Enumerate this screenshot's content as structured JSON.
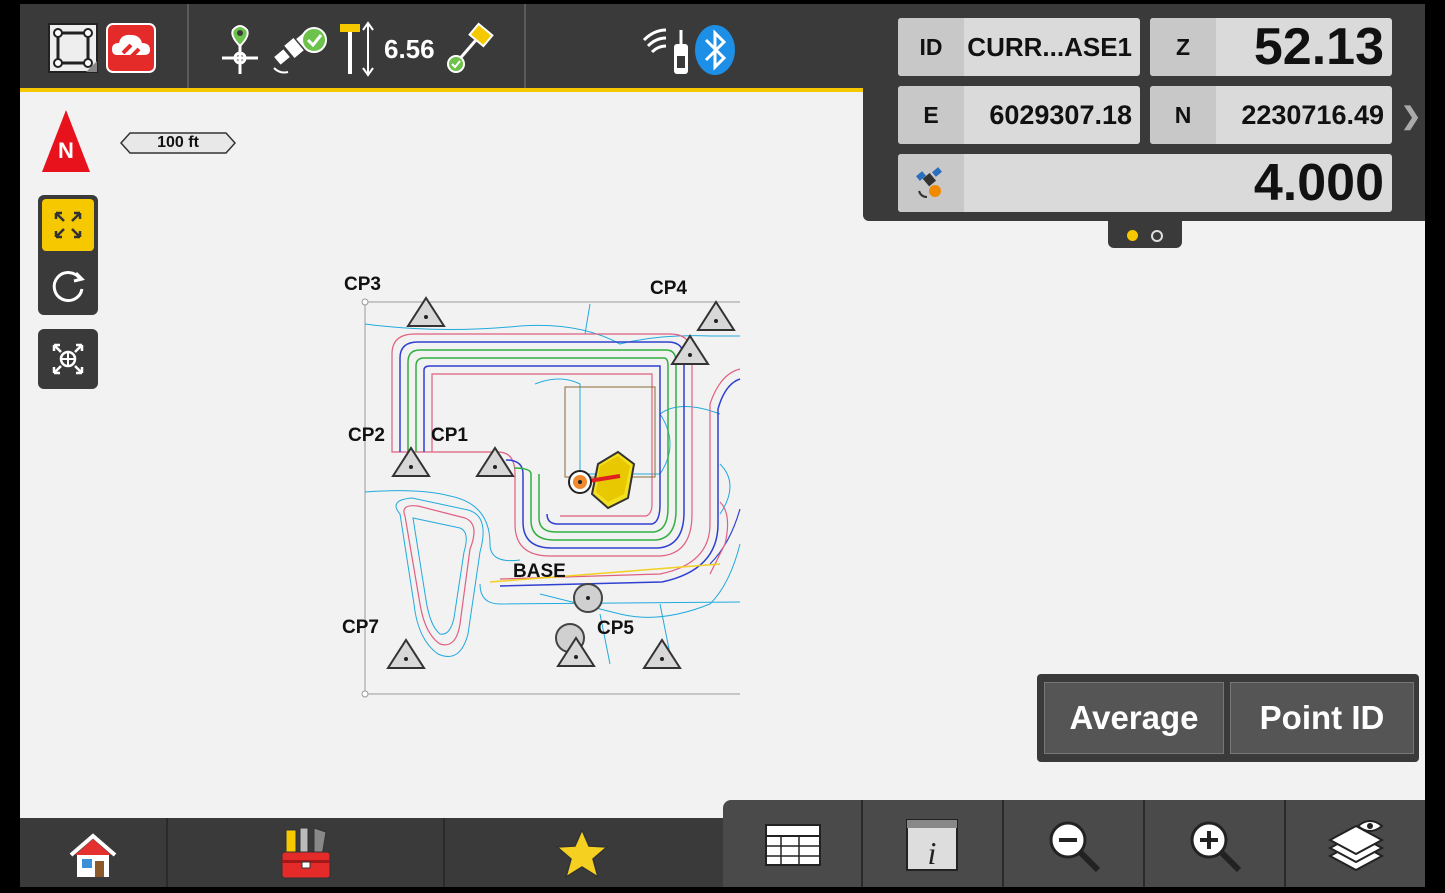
{
  "status_bar": {
    "height_value": "6.56",
    "icons": [
      "project-icon",
      "cloud-sync-icon",
      "gps-point-icon",
      "satellite-fix-icon",
      "rod-height-icon",
      "rover-receiver-icon",
      "radio-icon",
      "bluetooth-icon"
    ]
  },
  "coordinates": {
    "id_label": "ID",
    "id_value": "CURR...ASE1",
    "z_label": "Z",
    "z_value": "52.13",
    "e_label": "E",
    "e_value": "6029307.18",
    "n_label": "N",
    "n_value": "2230716.49",
    "precision_value": "4.000",
    "more_arrow": "❯"
  },
  "map": {
    "north_label": "N",
    "scale_label": "100 ft",
    "points": [
      "CP3",
      "CP4",
      "CP2",
      "CP1",
      "BASE",
      "CP7",
      "CP5"
    ]
  },
  "actions": {
    "average_label": "Average",
    "point_id_label": "Point ID"
  },
  "colors": {
    "accent": "#f5c800",
    "bar": "#3a3a3a",
    "north": "#e8121c"
  }
}
